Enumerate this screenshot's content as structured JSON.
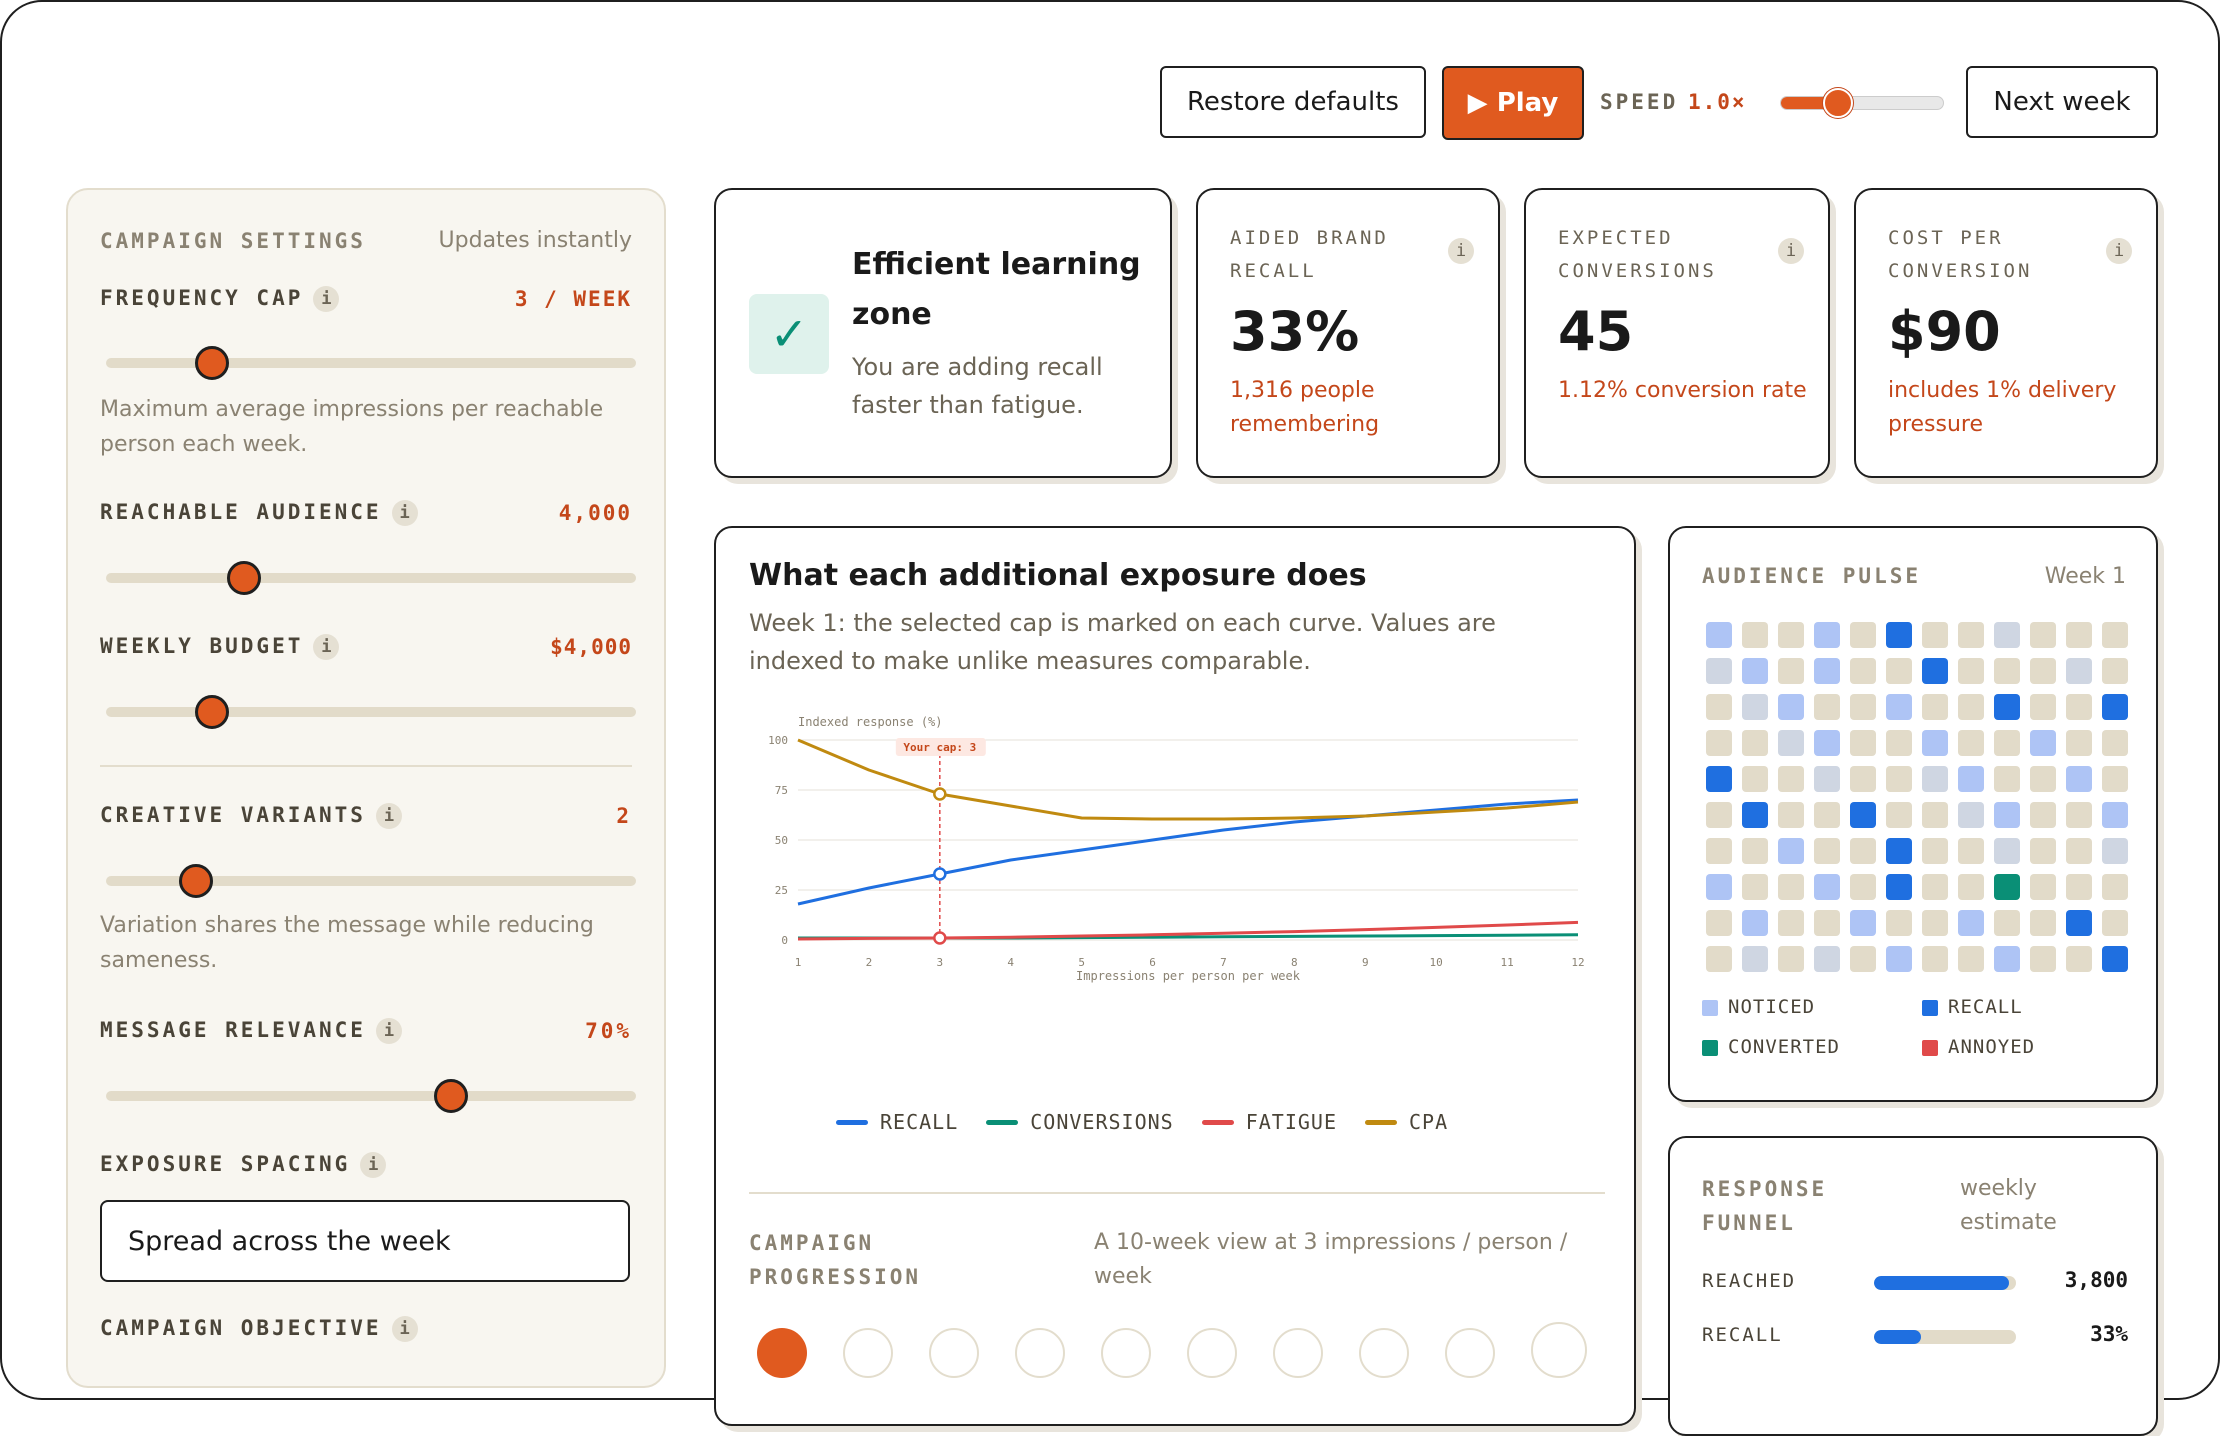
{
  "colors": {
    "accent": "#e05a1f",
    "recall": "#1f6fe0",
    "conversions": "#0a8f76",
    "fatigue": "#e04a4a",
    "cpa": "#c08a10",
    "noticed": "#aec4f5",
    "neutral": "#e2dbc9",
    "idle": "#cfd6e2"
  },
  "toolbar": {
    "restore_label": "Restore defaults",
    "play_label": "▶ Play",
    "speed_label": "SPEED",
    "speed_value": "1.0×",
    "speed_level": 0.35,
    "next_label": "Next week"
  },
  "settings": {
    "title": "CAMPAIGN SETTINGS",
    "updates": "Updates instantly",
    "frequency": {
      "label": "FREQUENCY CAP",
      "value": "3 / WEEK",
      "level": 0.2,
      "help": "Maximum average impressions per reachable person each week."
    },
    "audience": {
      "label": "REACHABLE AUDIENCE",
      "value": "4,000",
      "level": 0.26
    },
    "budget": {
      "label": "WEEKLY BUDGET",
      "value": "$4,000",
      "level": 0.2
    },
    "variants": {
      "label": "CREATIVE VARIANTS",
      "value": "2",
      "level": 0.17,
      "help": "Variation shares the message while reducing sameness."
    },
    "relevance": {
      "label": "MESSAGE RELEVANCE",
      "value": "70%",
      "level": 0.65
    },
    "spacing": {
      "label": "EXPOSURE SPACING",
      "value": "Spread across the week"
    },
    "objective": {
      "label": "CAMPAIGN OBJECTIVE"
    }
  },
  "status": {
    "title": "Efficient learning zone",
    "text": "You are adding recall faster than fatigue.",
    "icon": "check-icon"
  },
  "metrics": [
    {
      "label": "AIDED BRAND RECALL",
      "value": "33%",
      "sub": "1,316 people remembering"
    },
    {
      "label": "EXPECTED CONVERSIONS",
      "value": "45",
      "sub": "1.12% conversion rate"
    },
    {
      "label": "COST PER CONVERSION",
      "value": "$90",
      "sub": "includes 1% delivery pressure"
    }
  ],
  "exposure": {
    "title": "What each additional exposure does",
    "subtitle": "Week 1: the selected cap is marked on each curve. Values are indexed to make unlike measures comparable.",
    "cap_label": "Your cap: 3"
  },
  "chart_data": {
    "type": "line",
    "ylabel": "Indexed response (%)",
    "xlabel": "Impressions per person per week",
    "x": [
      1,
      2,
      3,
      4,
      5,
      6,
      7,
      8,
      9,
      10,
      11,
      12
    ],
    "ylim": [
      0,
      100
    ],
    "yticks": [
      0,
      25,
      50,
      75,
      100
    ],
    "cap": 3,
    "series": [
      {
        "name": "RECALL",
        "color": "#1f6fe0",
        "values": [
          18,
          26,
          33,
          40,
          45,
          50,
          55,
          59,
          62,
          65,
          68,
          70
        ]
      },
      {
        "name": "CONVERSIONS",
        "color": "#0a8f76",
        "values": [
          1,
          1,
          1,
          1,
          1.2,
          1.4,
          1.6,
          1.8,
          2,
          2.2,
          2.4,
          2.6
        ]
      },
      {
        "name": "FATIGUE",
        "color": "#e04a4a",
        "values": [
          0.5,
          0.8,
          1,
          1.4,
          2,
          2.6,
          3.4,
          4.2,
          5.2,
          6.3,
          7.5,
          8.8
        ]
      },
      {
        "name": "CPA",
        "color": "#c08a10",
        "values": [
          100,
          85,
          73,
          67,
          61,
          60.5,
          60.5,
          61,
          62,
          64,
          66,
          69
        ]
      }
    ],
    "grid": true,
    "legend": "bottom"
  },
  "progression": {
    "title": "CAMPAIGN PROGRESSION",
    "text": "A 10-week view at 3 impressions / person / week"
  },
  "pulse": {
    "title": "AUDIENCE PULSE",
    "week": "Week 1",
    "cells": [
      "n",
      "e",
      "e",
      "n",
      "e",
      "r",
      "e",
      "e",
      "i",
      "e",
      "e",
      "e",
      "i",
      "n",
      "e",
      "n",
      "e",
      "e",
      "r",
      "e",
      "e",
      "e",
      "i",
      "e",
      "e",
      "i",
      "n",
      "e",
      "e",
      "n",
      "e",
      "e",
      "r",
      "e",
      "e",
      "r",
      "e",
      "e",
      "i",
      "n",
      "e",
      "e",
      "n",
      "e",
      "e",
      "n",
      "e",
      "e",
      "r",
      "e",
      "e",
      "i",
      "e",
      "e",
      "i",
      "n",
      "e",
      "e",
      "n",
      "e",
      "e",
      "r",
      "e",
      "e",
      "r",
      "e",
      "e",
      "i",
      "n",
      "e",
      "e",
      "n",
      "e",
      "e",
      "n",
      "e",
      "e",
      "r",
      "e",
      "e",
      "i",
      "e",
      "e",
      "i",
      "n",
      "e",
      "e",
      "n",
      "e",
      "r",
      "e",
      "e",
      "c",
      "e",
      "e",
      "e",
      "e",
      "n",
      "e",
      "e",
      "n",
      "e",
      "e",
      "n",
      "e",
      "e",
      "r",
      "e",
      "e",
      "i",
      "e",
      "i",
      "e",
      "n",
      "e",
      "e",
      "n",
      "e",
      "e",
      "r"
    ],
    "legend": [
      {
        "label": "NOTICED",
        "color": "#aec4f5"
      },
      {
        "label": "RECALL",
        "color": "#1f6fe0"
      },
      {
        "label": "CONVERTED",
        "color": "#0a8f76"
      },
      {
        "label": "ANNOYED",
        "color": "#e04a4a"
      }
    ]
  },
  "funnel": {
    "title": "RESPONSE FUNNEL",
    "note": "weekly estimate",
    "rows": [
      {
        "label": "REACHED",
        "value": "3,800",
        "fraction": 0.95
      },
      {
        "label": "RECALL",
        "value": "33%",
        "fraction": 0.33
      }
    ]
  }
}
